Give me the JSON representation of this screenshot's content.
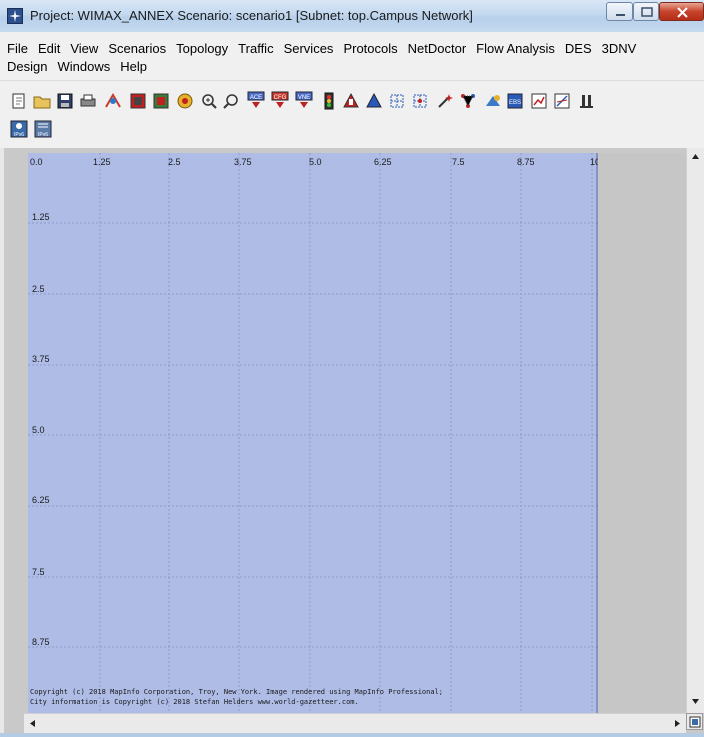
{
  "window": {
    "title": "Project: WIMAX_ANNEX Scenario: scenario1  [Subnet: top.Campus Network]",
    "buttons": [
      "minimize",
      "maximize",
      "close"
    ]
  },
  "menu": {
    "row1": [
      "File",
      "Edit",
      "View",
      "Scenarios",
      "Topology",
      "Traffic",
      "Services",
      "Protocols",
      "NetDoctor",
      "Flow Analysis",
      "DES",
      "3DNV"
    ],
    "row2": [
      "Design",
      "Windows",
      "Help"
    ]
  },
  "toolbar": {
    "icons": [
      "new-project-icon",
      "open-folder-icon",
      "save-icon",
      "print-icon",
      "object-palette-icon",
      "verify-links-icon",
      "fail-recover-icon",
      "node-status-icon",
      "zoom-in-icon",
      "zoom-out-icon",
      "ace-icon",
      "cfg-icon",
      "vne-icon",
      "config-sim-icon",
      "run-sim-icon",
      "triangle-icon",
      "grid-network-icon",
      "grid-network2-icon",
      "wand-icon",
      "topology-icon",
      "import-icon",
      "results-icon",
      "view-results-icon",
      "graph-icon",
      "split-icon"
    ],
    "row2_icons": [
      "ipv6-node-icon",
      "ipv6-config-icon"
    ],
    "badges": {
      "ace": "ACE",
      "cfg": "CFG",
      "vne": "VNE",
      "ipv6": "IPv6",
      "ebs": "EBS"
    }
  },
  "map": {
    "x_ticks": [
      "0.0",
      "1.25",
      "2.5",
      "3.75",
      "5.0",
      "6.25",
      "7.5",
      "8.75",
      "10"
    ],
    "y_ticks": [
      "1.25",
      "2.5",
      "3.75",
      "5.0",
      "6.25",
      "7.5",
      "8.75"
    ],
    "copyright_line1": "Copyright (c) 2018 MapInfo Corporation, Troy, New York. Image rendered using MapInfo Professional;",
    "copyright_line2": "City information is Copyright (c) 2018 Stefan Helders www.world-gazetteer.com.",
    "background_color": "#aebce6",
    "grid_color": "#8f9ec8"
  }
}
